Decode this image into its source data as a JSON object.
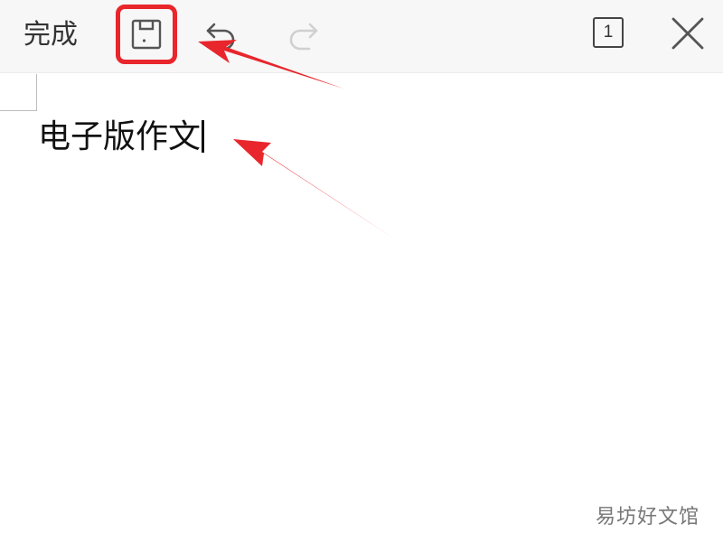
{
  "toolbar": {
    "done_label": "完成",
    "save_icon": "floppy-disk-icon",
    "undo_icon": "undo-icon",
    "redo_icon": "redo-icon",
    "redo_enabled": false,
    "page_count": "1",
    "close_icon": "close-icon"
  },
  "document": {
    "text": "电子版作文"
  },
  "annotation": {
    "highlight_color": "#e8262c",
    "arrow_color": "#e8262c"
  },
  "watermark": "易坊好文馆"
}
